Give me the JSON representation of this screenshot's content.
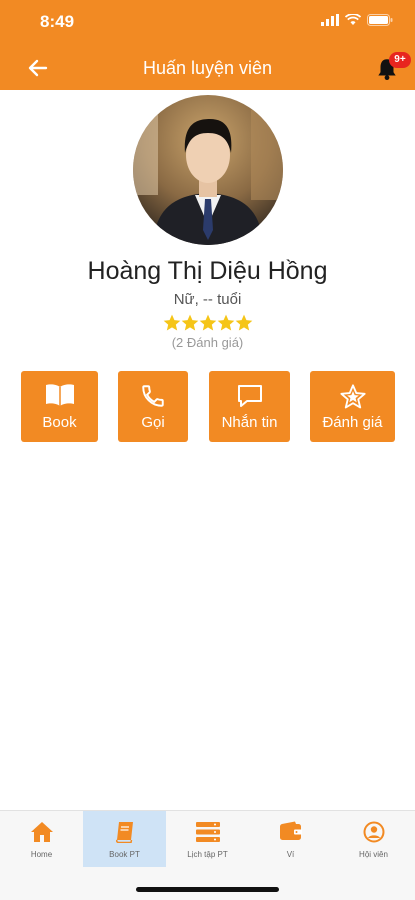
{
  "status": {
    "time": "8:49"
  },
  "header": {
    "title": "Huấn luyện viên",
    "notification_badge": "9+"
  },
  "profile": {
    "name": "Hoàng Thị Diệu Hồng",
    "info": "Nữ, -- tuổi",
    "rating_stars": 5,
    "rating_count": "(2 Đánh giá)"
  },
  "actions": [
    {
      "label": "Book",
      "icon": "book-icon"
    },
    {
      "label": "Gọi",
      "icon": "phone-icon"
    },
    {
      "label": "Nhắn tin",
      "icon": "message-icon"
    },
    {
      "label": "Đánh giá",
      "icon": "star-rate-icon"
    }
  ],
  "tabs": [
    {
      "label": "Home",
      "icon": "home-icon"
    },
    {
      "label": "Book PT",
      "icon": "book-icon",
      "active": true
    },
    {
      "label": "Lịch tập PT",
      "icon": "schedule-icon"
    },
    {
      "label": "Ví",
      "icon": "wallet-icon"
    },
    {
      "label": "Hội viên",
      "icon": "user-icon"
    }
  ],
  "colors": {
    "accent": "#f28a23",
    "star": "#f5c518",
    "badge": "#e8261f",
    "active_tab": "#cfe3f6"
  }
}
